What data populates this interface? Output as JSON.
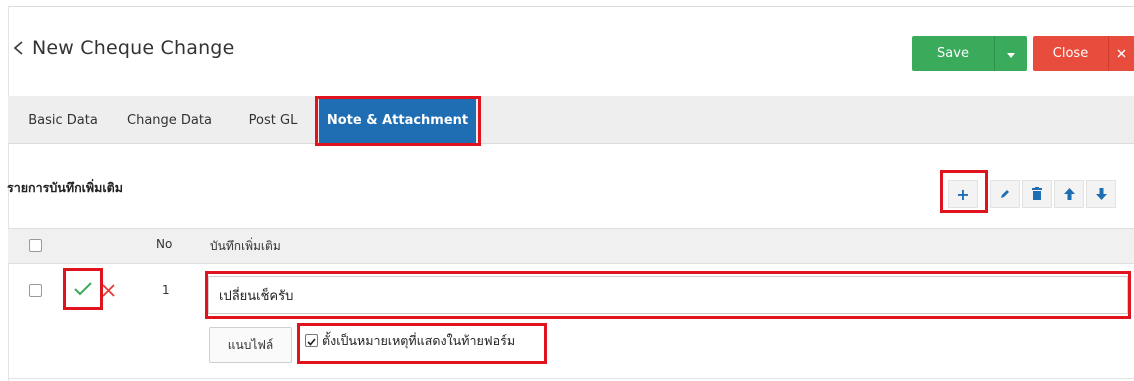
{
  "header": {
    "title": "New Cheque Change",
    "save_label": "Save",
    "close_label": "Close"
  },
  "tabs": [
    {
      "label": "Basic Data"
    },
    {
      "label": "Change Data"
    },
    {
      "label": "Post GL"
    },
    {
      "label": "Note & Attachment",
      "active": true
    }
  ],
  "section": {
    "title": "รายการบันทึกเพิ่มเติม"
  },
  "toolbar": {
    "add_symbol": "+",
    "icons": [
      "plus-icon",
      "pencil-icon",
      "trash-icon",
      "arrow-up-icon",
      "arrow-down-icon"
    ]
  },
  "table": {
    "columns": [
      "No",
      "บันทึกเพิ่มเติม"
    ],
    "rows": [
      {
        "no": "1",
        "note": "เปลี่ยนเช็ครับ"
      }
    ]
  },
  "attachment": {
    "button_label": "แนบไฟล์",
    "show_on_form_label": "ตั้งเป็นหมายเหตุที่แสดงในท้ายฟอร์ม",
    "show_on_form_checked": true
  },
  "colors": {
    "save": "#3aaa5b",
    "close": "#e74c3c",
    "active_tab": "#1f6eb4",
    "highlight": "#e0141e",
    "confirm": "#3aaa5b",
    "cancel": "#e53935"
  }
}
